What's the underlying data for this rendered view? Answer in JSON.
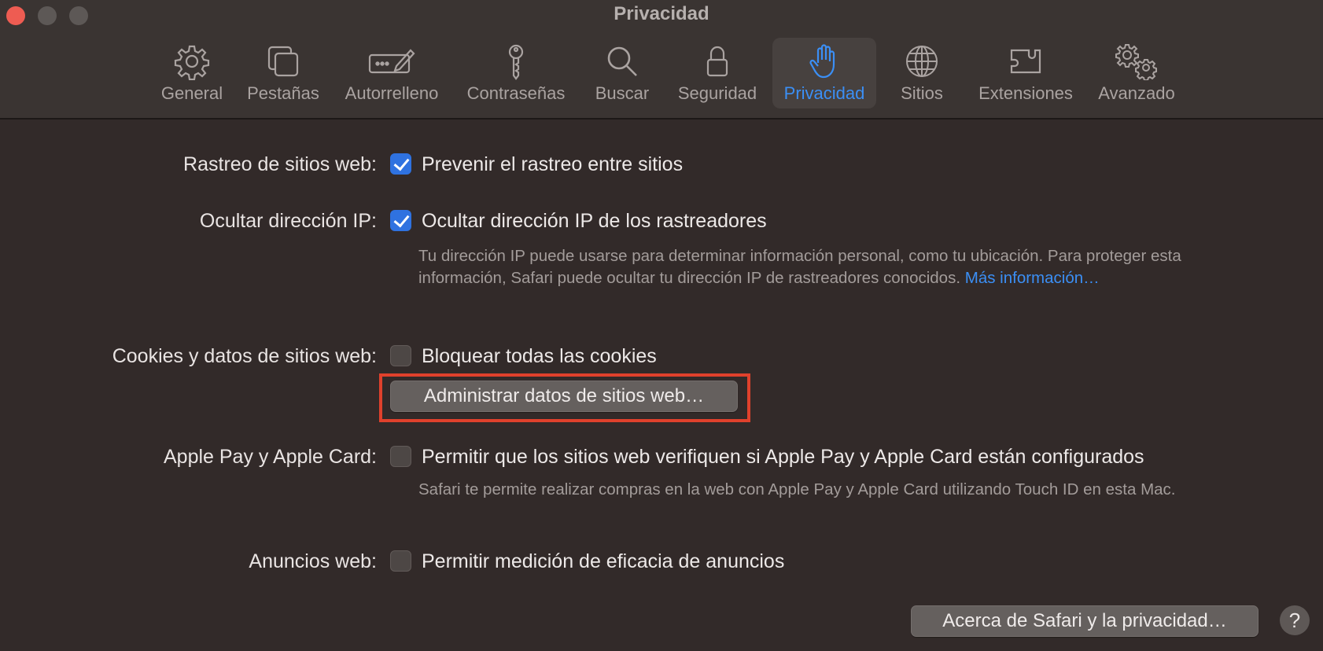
{
  "window": {
    "title": "Privacidad"
  },
  "toolbar": {
    "tabs": [
      {
        "label": "General",
        "icon": "gear-icon"
      },
      {
        "label": "Pestañas",
        "icon": "tabs-icon"
      },
      {
        "label": "Autorrelleno",
        "icon": "autofill-icon"
      },
      {
        "label": "Contraseñas",
        "icon": "key-icon"
      },
      {
        "label": "Buscar",
        "icon": "search-icon"
      },
      {
        "label": "Seguridad",
        "icon": "lock-icon"
      },
      {
        "label": "Privacidad",
        "icon": "hand-icon"
      },
      {
        "label": "Sitios",
        "icon": "globe-icon"
      },
      {
        "label": "Extensiones",
        "icon": "puzzle-icon"
      },
      {
        "label": "Avanzado",
        "icon": "gears-icon"
      }
    ],
    "active": "Privacidad"
  },
  "settings": {
    "tracking": {
      "label": "Rastreo de sitios web:",
      "option": "Prevenir el rastreo entre sitios",
      "checked": true
    },
    "hide_ip": {
      "label": "Ocultar dirección IP:",
      "option": "Ocultar dirección IP de los rastreadores",
      "checked": true,
      "note": "Tu dirección IP puede usarse para determinar información personal, como tu ubicación. Para proteger esta información, Safari puede ocultar tu dirección IP de rastreadores conocidos.",
      "link": "Más información…"
    },
    "cookies": {
      "label": "Cookies y datos de sitios web:",
      "option": "Bloquear todas las cookies",
      "checked": false,
      "button": "Administrar datos de sitios web…"
    },
    "apple_pay": {
      "label": "Apple Pay y Apple Card:",
      "option": "Permitir que los sitios web verifiquen si Apple Pay y Apple Card están configurados",
      "checked": false,
      "note": "Safari te permite realizar compras en la web con Apple Pay y Apple Card utilizando Touch ID en esta Mac."
    },
    "ads": {
      "label": "Anuncios web:",
      "option": "Permitir medición de eficacia de anuncios",
      "checked": false
    }
  },
  "footer": {
    "about_button": "Acerca de Safari y la privacidad…",
    "help": "?"
  },
  "colors": {
    "accent": "#3b8ff5",
    "highlight": "#e0412c",
    "background": "#322a29"
  }
}
